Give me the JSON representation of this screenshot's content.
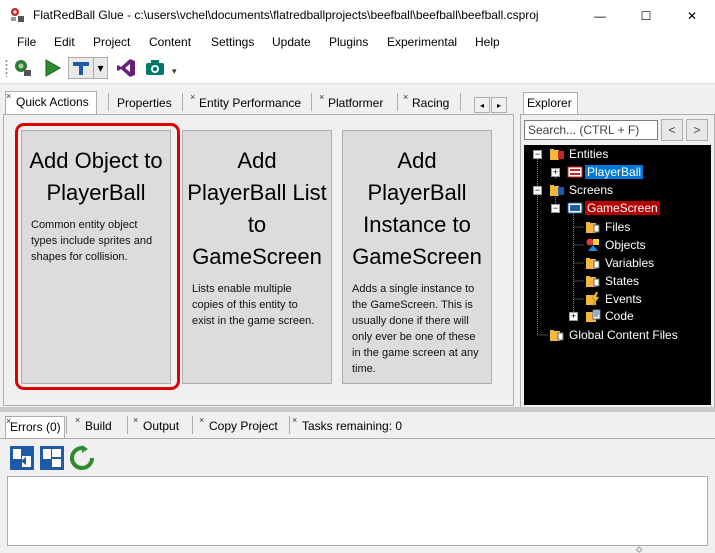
{
  "window": {
    "title": "FlatRedBall Glue - c:\\users\\vchel\\documents\\flatredballprojects\\beefball\\beefball\\beefball.csproj",
    "min_glyph": "—",
    "max_glyph": "☐",
    "close_glyph": "✕"
  },
  "menu": [
    "File",
    "Edit",
    "Project",
    "Content",
    "Settings",
    "Update",
    "Plugins",
    "Experimental",
    "Help"
  ],
  "toolbar": {
    "overflow_glyph": "▾",
    "dropdown_glyph": "▾"
  },
  "tabs": {
    "close_glyph": "×",
    "items": [
      "Quick Actions",
      "Properties",
      "Entity Performance",
      "Platformer",
      "Racing"
    ],
    "nav_left": "◂",
    "nav_right": "▸"
  },
  "cards": [
    {
      "title": "Add Object to PlayerBall",
      "desc": "Common entity object types include sprites and shapes for collision."
    },
    {
      "title": "Add PlayerBall List to GameScreen",
      "desc": "Lists enable multiple copies of this entity to exist in the game screen."
    },
    {
      "title": "Add PlayerBall Instance to GameScreen",
      "desc": "Adds a single instance to the GameScreen. This is usually done if there will only ever be one of these in the game screen at any time."
    }
  ],
  "explorer": {
    "tab_label": "Explorer",
    "search_placeholder": "Search... (CTRL + F)",
    "back_glyph": "<",
    "forward_glyph": ">",
    "tree": [
      {
        "label": "Entities",
        "expander": "−"
      },
      {
        "label": "PlayerBall",
        "expander": "+"
      },
      {
        "label": "Screens",
        "expander": "−"
      },
      {
        "label": "GameScreen",
        "expander": "−"
      },
      {
        "label": "Files"
      },
      {
        "label": "Objects"
      },
      {
        "label": "Variables"
      },
      {
        "label": "States"
      },
      {
        "label": "Events"
      },
      {
        "label": "Code",
        "expander": "+"
      },
      {
        "label": "Global Content Files"
      }
    ]
  },
  "bottom_tabs": [
    "Errors (0)",
    "Build",
    "Output",
    "Copy Project",
    "Tasks remaining: 0"
  ],
  "colors": {
    "highlight": "#e00000",
    "tree_background": "#000000",
    "selection_blue": "#0078d7",
    "selection_red": "#b40000"
  }
}
